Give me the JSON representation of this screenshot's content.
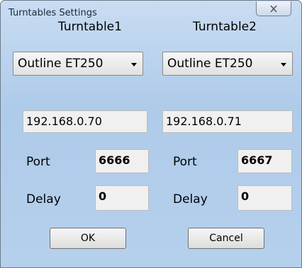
{
  "window": {
    "title": "Turntables Settings"
  },
  "turntables": [
    {
      "header": "Turntable1",
      "model": "Outline ET250",
      "ip": "192.168.0.70",
      "port_label": "Port",
      "port": "6666",
      "delay_label": "Delay",
      "delay": "0"
    },
    {
      "header": "Turntable2",
      "model": "Outline ET250",
      "ip": "192.168.0.71",
      "port_label": "Port",
      "port": "6667",
      "delay_label": "Delay",
      "delay": "0"
    }
  ],
  "buttons": {
    "ok": "OK",
    "cancel": "Cancel"
  }
}
